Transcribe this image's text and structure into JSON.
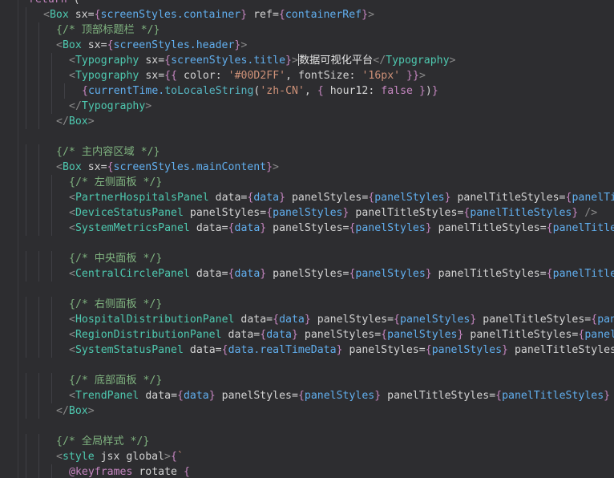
{
  "editor": {
    "lines": [
      {
        "text": "return (",
        "indent": 1
      },
      {
        "text": "<Box sx={screenStyles.container} ref={containerRef}>",
        "indent": 2
      },
      {
        "text": "{/* 顶部标题栏 */}",
        "indent": 3
      },
      {
        "text": "<Box sx={screenStyles.header}>",
        "indent": 3
      },
      {
        "text": "<Typography sx={screenStyles.title}>数据可视化平台</Typography>",
        "indent": 4
      },
      {
        "text": "<Typography sx={{ color: '#00D2FF', fontSize: '16px' }}>",
        "indent": 4
      },
      {
        "text": "{currentTime.toLocaleString('zh-CN', { hour12: false })}",
        "indent": 5
      },
      {
        "text": "</Typography>",
        "indent": 4
      },
      {
        "text": "</Box>",
        "indent": 3
      },
      {
        "text": "",
        "indent": 0
      },
      {
        "text": "{/* 主内容区域 */}",
        "indent": 3
      },
      {
        "text": "<Box sx={screenStyles.mainContent}>",
        "indent": 3
      },
      {
        "text": "{/* 左侧面板 */}",
        "indent": 4
      },
      {
        "text": "<PartnerHospitalsPanel data={data} panelStyles={panelStyles} panelTitleStyles={panelTitleStyles} />",
        "indent": 4
      },
      {
        "text": "<DeviceStatusPanel panelStyles={panelStyles} panelTitleStyles={panelTitleStyles} />",
        "indent": 4
      },
      {
        "text": "<SystemMetricsPanel data={data} panelStyles={panelStyles} panelTitleStyles={panelTitleStyles} />",
        "indent": 4
      },
      {
        "text": "",
        "indent": 0
      },
      {
        "text": "{/* 中央面板 */}",
        "indent": 4
      },
      {
        "text": "<CentralCirclePanel data={data} panelStyles={panelStyles} panelTitleStyles={panelTitleStyles} />",
        "indent": 4
      },
      {
        "text": "",
        "indent": 0
      },
      {
        "text": "{/* 右侧面板 */}",
        "indent": 4
      },
      {
        "text": "<HospitalDistributionPanel data={data} panelStyles={panelStyles} panelTitleStyles={panelTitleStyles} />",
        "indent": 4
      },
      {
        "text": "<RegionDistributionPanel data={data} panelStyles={panelStyles} panelTitleStyles={panelTitleStyles} />",
        "indent": 4
      },
      {
        "text": "<SystemStatusPanel data={data.realTimeData} panelStyles={panelStyles} panelTitleStyles={panelTitleStyles} />",
        "indent": 4
      },
      {
        "text": "",
        "indent": 0
      },
      {
        "text": "{/* 底部面板 */}",
        "indent": 4
      },
      {
        "text": "<TrendPanel data={data} panelStyles={panelStyles} panelTitleStyles={panelTitleStyles} />",
        "indent": 4
      },
      {
        "text": "</Box>",
        "indent": 3
      },
      {
        "text": "",
        "indent": 0
      },
      {
        "text": "{/* 全局样式 */}",
        "indent": 3
      },
      {
        "text": "<style jsx global>{`",
        "indent": 3
      },
      {
        "text": "@keyframes rotate {",
        "indent": 4
      }
    ],
    "caret_line": 4
  },
  "colors": {
    "background": "#2d2d30",
    "tag": "#4ec9b0",
    "variable": "#61afef",
    "string": "#ce9178",
    "comment": "#7fb27f",
    "keyword": "#c586c0",
    "punctuation": "#8a8a8a"
  }
}
